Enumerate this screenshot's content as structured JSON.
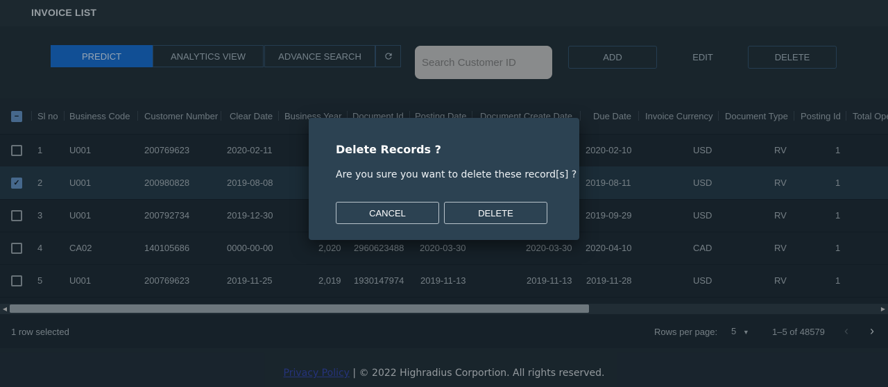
{
  "app": {
    "title": "INVOICE LIST"
  },
  "toolbar": {
    "predict": "PREDICT",
    "analytics": "ANALYTICS VIEW",
    "advance_search": "ADVANCE SEARCH",
    "refresh_icon": "refresh-icon",
    "search_placeholder": "Search Customer ID",
    "add": "ADD",
    "edit": "EDIT",
    "delete": "DELETE"
  },
  "table": {
    "columns": [
      "Sl no",
      "Business Code",
      "Customer Number",
      "Clear Date",
      "Business Year",
      "Document Id",
      "Posting Date",
      "Document Create Date",
      "Due Date",
      "Invoice Currency",
      "Document Type",
      "Posting Id",
      "Total Ope"
    ],
    "rows": [
      {
        "checked": false,
        "sl": "1",
        "business_code": "U001",
        "customer_number": "200769623",
        "clear_date": "2020-02-11",
        "business_year": "",
        "document_id": "",
        "posting_date": "",
        "document_create_date": "",
        "due_date": "2020-02-10",
        "currency": "USD",
        "doc_type": "RV",
        "posting_id": "1"
      },
      {
        "checked": true,
        "sl": "2",
        "business_code": "U001",
        "customer_number": "200980828",
        "clear_date": "2019-08-08",
        "business_year": "",
        "document_id": "",
        "posting_date": "",
        "document_create_date": "",
        "due_date": "2019-08-11",
        "currency": "USD",
        "doc_type": "RV",
        "posting_id": "1"
      },
      {
        "checked": false,
        "sl": "3",
        "business_code": "U001",
        "customer_number": "200792734",
        "clear_date": "2019-12-30",
        "business_year": "",
        "document_id": "",
        "posting_date": "",
        "document_create_date": "",
        "due_date": "2019-09-29",
        "currency": "USD",
        "doc_type": "RV",
        "posting_id": "1"
      },
      {
        "checked": false,
        "sl": "4",
        "business_code": "CA02",
        "customer_number": "140105686",
        "clear_date": "0000-00-00",
        "business_year": "2,020",
        "document_id": "2960623488",
        "posting_date": "2020-03-30",
        "document_create_date": "2020-03-30",
        "due_date": "2020-04-10",
        "currency": "CAD",
        "doc_type": "RV",
        "posting_id": "1"
      },
      {
        "checked": false,
        "sl": "5",
        "business_code": "U001",
        "customer_number": "200769623",
        "clear_date": "2019-11-25",
        "business_year": "2,019",
        "document_id": "1930147974",
        "posting_date": "2019-11-13",
        "document_create_date": "2019-11-13",
        "due_date": "2019-11-28",
        "currency": "USD",
        "doc_type": "RV",
        "posting_id": "1"
      }
    ]
  },
  "footer": {
    "selected": "1 row selected",
    "rows_per_page_label": "Rows per page:",
    "rows_per_page_value": "5",
    "range": "1–5 of 48579"
  },
  "dialog": {
    "title": "Delete Records ?",
    "message": "Are you sure you want to delete these record[s] ?",
    "cancel": "CANCEL",
    "delete": "DELETE"
  },
  "copyright": {
    "link": "Privacy Policy",
    "text": " | © 2022 Highradius Corportion. All rights reserved."
  }
}
